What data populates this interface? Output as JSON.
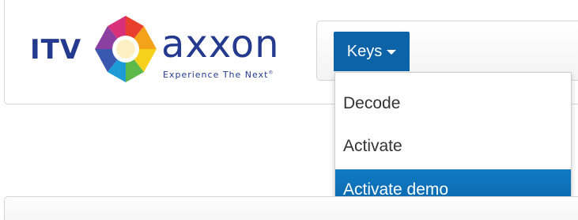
{
  "logo": {
    "itv": "ITV",
    "axxon": "axxon",
    "tagline": "Experience The Next",
    "trademark": "®"
  },
  "colors": {
    "brand_blue": "#243a8e",
    "accent": "#0c63a7",
    "active_item": "#0a6bb0"
  },
  "nav": {
    "keys_label": "Keys",
    "caret_icon": "caret-down-icon"
  },
  "dropdown": {
    "items": [
      {
        "label": "Decode"
      },
      {
        "label": "Activate"
      },
      {
        "label": "Activate demo",
        "active": true
      }
    ]
  }
}
